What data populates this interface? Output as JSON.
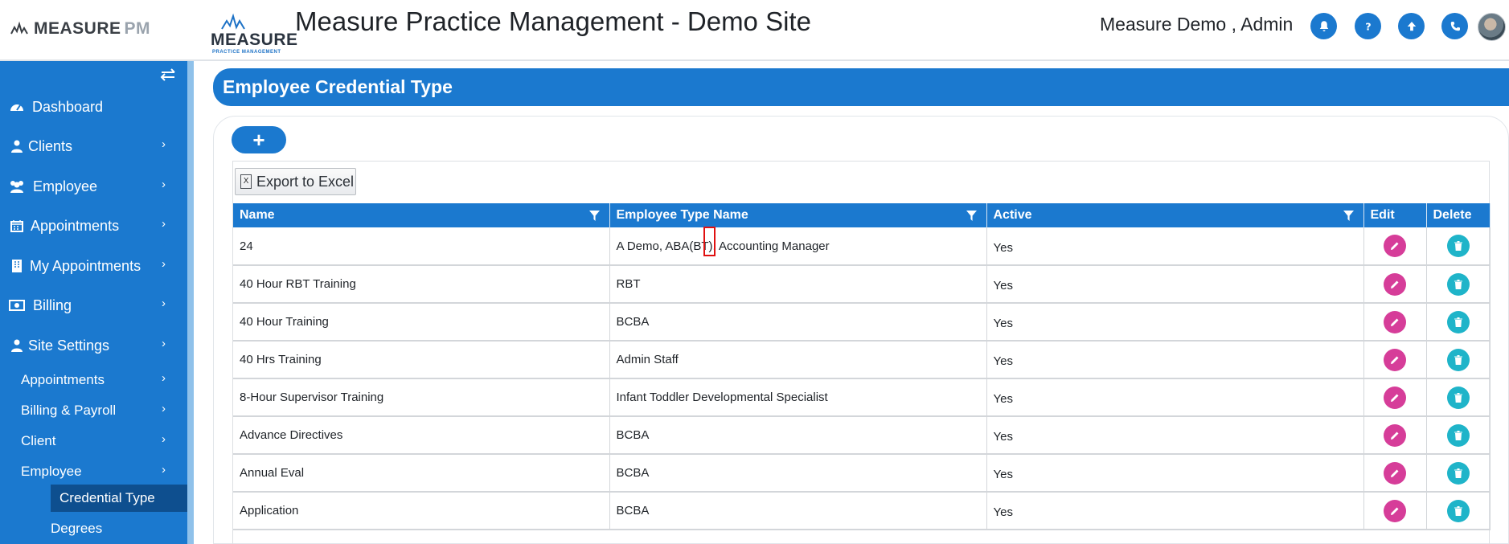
{
  "header": {
    "brand_left": "MEASURE",
    "brand_left_suffix": "PM",
    "brand_logo_word": "MEASURE",
    "brand_logo_sub": "PRACTICE MANAGEMENT",
    "site_title": "Measure Practice Management - Demo Site",
    "user_name": "Measure Demo , Admin",
    "icons": [
      "bell-icon",
      "help-icon",
      "upload-icon",
      "phone-icon"
    ]
  },
  "sidebar": {
    "items": [
      {
        "label": "Dashboard",
        "icon": "dashboard-icon",
        "has_chevron": false
      },
      {
        "label": "Clients",
        "icon": "user-icon",
        "has_chevron": true
      },
      {
        "label": "Employee",
        "icon": "users-icon",
        "has_chevron": true
      },
      {
        "label": "Appointments",
        "icon": "calendar-icon",
        "has_chevron": true
      },
      {
        "label": "My Appointments",
        "icon": "building-icon",
        "has_chevron": true
      },
      {
        "label": "Billing",
        "icon": "money-icon",
        "has_chevron": true
      },
      {
        "label": "Site Settings",
        "icon": "user-icon",
        "has_chevron": true
      }
    ],
    "sub_items": [
      {
        "label": "Appointments"
      },
      {
        "label": "Billing & Payroll"
      },
      {
        "label": "Client"
      },
      {
        "label": "Employee"
      }
    ],
    "sub_sub_items": [
      {
        "label": "Credential Type",
        "active": true
      },
      {
        "label": "Degrees",
        "active": false
      }
    ]
  },
  "main": {
    "page_title": "Employee Credential Type",
    "add_label": "+",
    "export_label": "Export to Excel",
    "columns": [
      "Name",
      "Employee Type Name",
      "Active",
      "Edit",
      "Delete"
    ],
    "rows": [
      {
        "name": "24",
        "type": "A Demo, ABA(BT), Accounting Manager",
        "active": "Yes"
      },
      {
        "name": "40 Hour RBT Training",
        "type": "RBT",
        "active": "Yes"
      },
      {
        "name": "40 Hour Training",
        "type": "BCBA",
        "active": "Yes"
      },
      {
        "name": "40 Hrs Training",
        "type": "Admin Staff",
        "active": "Yes"
      },
      {
        "name": "8-Hour Supervisor Training",
        "type": "Infant Toddler Developmental Specialist",
        "active": "Yes"
      },
      {
        "name": "Advance Directives",
        "type": "BCBA",
        "active": "Yes"
      },
      {
        "name": "Annual Eval",
        "type": "BCBA",
        "active": "Yes"
      },
      {
        "name": "Application",
        "type": "BCBA",
        "active": "Yes"
      }
    ]
  },
  "colors": {
    "primary": "#1b79cf",
    "edit": "#d63d99",
    "delete": "#1fb4c9",
    "active_nav": "#0e4f8f"
  }
}
